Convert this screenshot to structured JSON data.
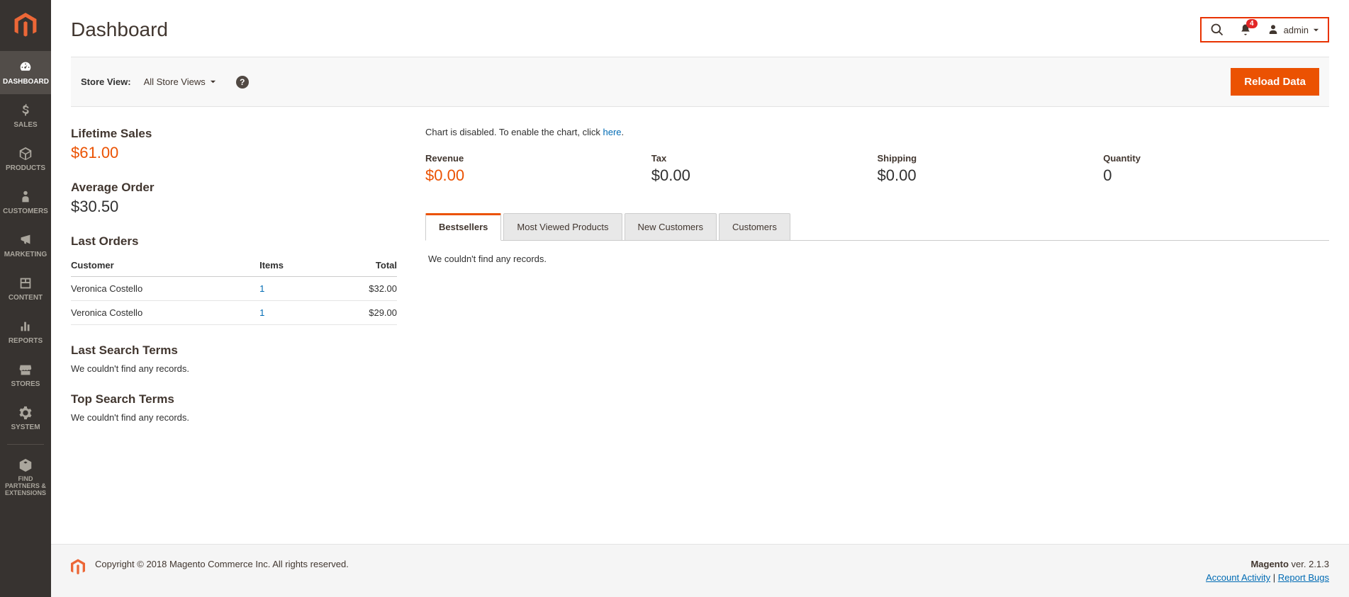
{
  "page_title": "Dashboard",
  "header": {
    "notification_count": "4",
    "admin_label": "admin"
  },
  "toolbar": {
    "store_view_label": "Store View:",
    "store_view_value": "All Store Views",
    "reload_label": "Reload Data"
  },
  "sidebar": {
    "items": [
      {
        "label": "DASHBOARD"
      },
      {
        "label": "SALES"
      },
      {
        "label": "PRODUCTS"
      },
      {
        "label": "CUSTOMERS"
      },
      {
        "label": "MARKETING"
      },
      {
        "label": "CONTENT"
      },
      {
        "label": "REPORTS"
      },
      {
        "label": "STORES"
      },
      {
        "label": "SYSTEM"
      },
      {
        "label": "FIND PARTNERS & EXTENSIONS"
      }
    ]
  },
  "lifetime_sales": {
    "label": "Lifetime Sales",
    "value": "$61.00"
  },
  "average_order": {
    "label": "Average Order",
    "value": "$30.50"
  },
  "last_orders": {
    "title": "Last Orders",
    "cols": {
      "customer": "Customer",
      "items": "Items",
      "total": "Total"
    },
    "rows": [
      {
        "customer": "Veronica Costello",
        "items": "1",
        "total": "$32.00"
      },
      {
        "customer": "Veronica Costello",
        "items": "1",
        "total": "$29.00"
      }
    ]
  },
  "last_search": {
    "title": "Last Search Terms",
    "empty": "We couldn't find any records."
  },
  "top_search": {
    "title": "Top Search Terms",
    "empty": "We couldn't find any records."
  },
  "chart_msg": {
    "prefix": "Chart is disabled. To enable the chart, click ",
    "link": "here",
    "suffix": "."
  },
  "totals": {
    "revenue": {
      "label": "Revenue",
      "value": "$0.00"
    },
    "tax": {
      "label": "Tax",
      "value": "$0.00"
    },
    "shipping": {
      "label": "Shipping",
      "value": "$0.00"
    },
    "quantity": {
      "label": "Quantity",
      "value": "0"
    }
  },
  "tabs": {
    "bestsellers": "Bestsellers",
    "most_viewed": "Most Viewed Products",
    "new_customers": "New Customers",
    "customers": "Customers",
    "empty": "We couldn't find any records."
  },
  "footer": {
    "copyright": "Copyright © 2018 Magento Commerce Inc. All rights reserved.",
    "brand": "Magento",
    "version": " ver. 2.1.3",
    "account_activity": "Account Activity",
    "report_bugs": "Report Bugs",
    "sep": " | "
  }
}
